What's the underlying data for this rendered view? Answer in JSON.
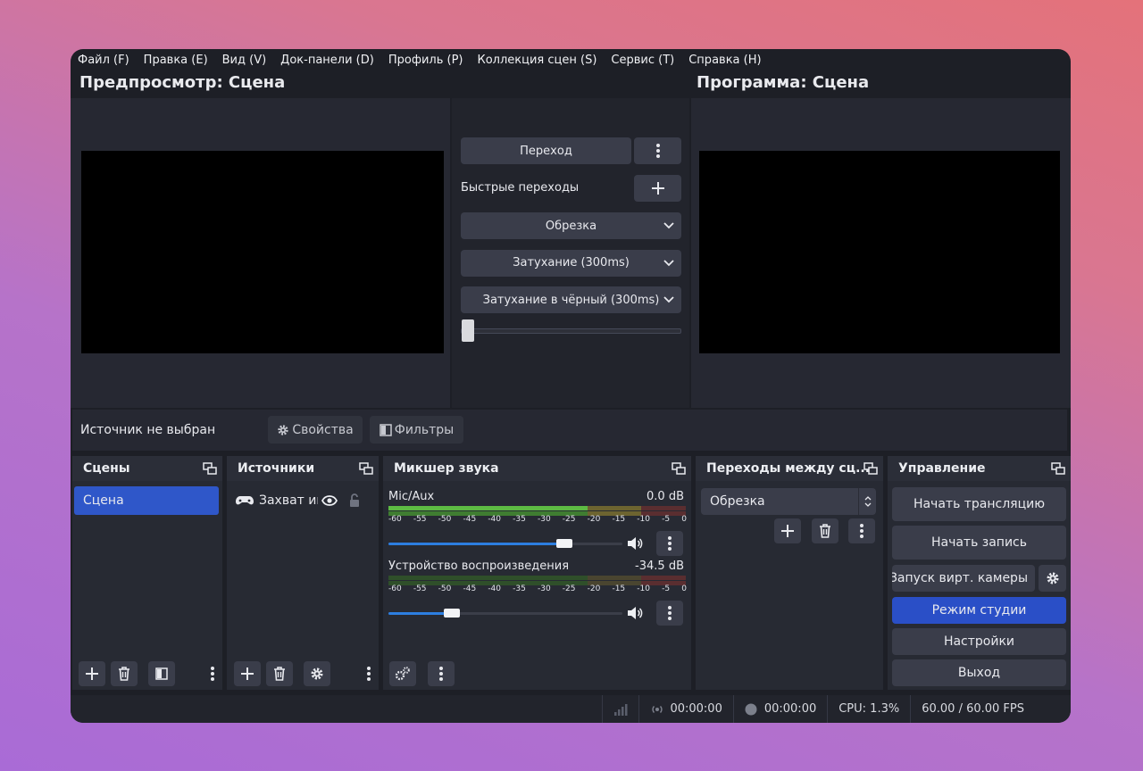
{
  "menu": [
    "Файл (F)",
    "Правка (E)",
    "Вид (V)",
    "Док-панели (D)",
    "Профиль (P)",
    "Коллекция сцен (S)",
    "Сервис (T)",
    "Справка (H)"
  ],
  "preview": {
    "title": "Предпросмотр: Сцена"
  },
  "program": {
    "title": "Программа: Сцена"
  },
  "transitions_center": {
    "transition_button": "Переход",
    "quick_label": "Быстрые переходы",
    "options": [
      "Обрезка",
      "Затухание (300ms)",
      "Затухание в чёрный (300ms)"
    ],
    "tbar": 0.0
  },
  "source_toolbar": {
    "no_source": "Источник не выбран",
    "properties": "Свойства",
    "filters": "Фильтры"
  },
  "scenes": {
    "title": "Сцены",
    "items": [
      "Сцена"
    ]
  },
  "sources": {
    "title": "Источники",
    "items": [
      "Захват иг"
    ]
  },
  "mixer": {
    "title": "Микшер звука",
    "ticks": [
      "-60",
      "-55",
      "-50",
      "-45",
      "-40",
      "-35",
      "-30",
      "-25",
      "-20",
      "-15",
      "-10",
      "-5",
      "0"
    ],
    "channels": [
      {
        "name": "Mic/Aux",
        "db": "0.0 dB",
        "volume": 0.75
      },
      {
        "name": "Устройство воспроизведения",
        "db": "-34.5 dB",
        "volume": 0.27
      }
    ]
  },
  "scene_transitions": {
    "title": "Переходы между сц...",
    "selected": "Обрезка"
  },
  "controls": {
    "title": "Управление",
    "start_stream": "Начать трансляцию",
    "start_record": "Начать запись",
    "virtual_cam": "Запуск вирт. камеры",
    "studio_mode": "Режим студии",
    "settings": "Настройки",
    "exit": "Выход"
  },
  "status": {
    "stream_time": "00:00:00",
    "rec_time": "00:00:00",
    "cpu": "CPU: 1.3%",
    "fps": "60.00 / 60.00 FPS"
  },
  "colors": {
    "accent": "#2a4fc7",
    "selection": "#2f57c9",
    "window_bg": "#1d1f26"
  }
}
